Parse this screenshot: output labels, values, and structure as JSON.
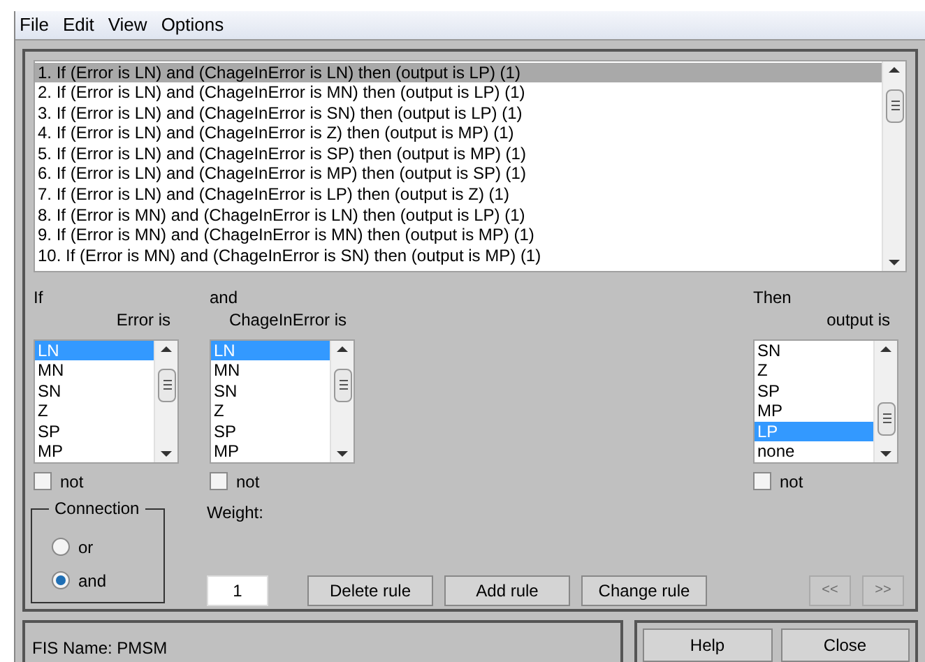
{
  "menu": [
    "File",
    "Edit",
    "View",
    "Options"
  ],
  "rules": [
    {
      "text": "1. If (Error is LN) and (ChageInError is LN) then (output is LP) (1)",
      "selected": true
    },
    {
      "text": "2. If (Error is LN) and (ChageInError is MN) then (output is LP) (1)",
      "selected": false
    },
    {
      "text": "3. If (Error is LN) and (ChageInError is SN) then (output is LP) (1)",
      "selected": false
    },
    {
      "text": "4. If (Error is LN) and (ChageInError is Z) then (output is MP) (1)",
      "selected": false
    },
    {
      "text": "5. If (Error is LN) and (ChageInError is SP) then (output is MP) (1)",
      "selected": false
    },
    {
      "text": "6. If (Error is LN) and (ChageInError is MP) then (output is SP) (1)",
      "selected": false
    },
    {
      "text": "7. If (Error is LN) and (ChageInError is LP) then (output is Z) (1)",
      "selected": false
    },
    {
      "text": "8. If (Error is MN) and (ChageInError is LN) then (output is LP) (1)",
      "selected": false
    },
    {
      "text": "9. If (Error is MN) and (ChageInError is MN) then (output is MP) (1)",
      "selected": false
    },
    {
      "text": "10. If (Error is MN) and (ChageInError is SN) then (output is MP) (1)",
      "selected": false
    }
  ],
  "variables": [
    {
      "prefix": "If",
      "label": "Error is",
      "items": [
        {
          "text": "LN",
          "selected": true
        },
        {
          "text": "MN",
          "selected": false
        },
        {
          "text": "SN",
          "selected": false
        },
        {
          "text": "Z",
          "selected": false
        },
        {
          "text": "SP",
          "selected": false
        },
        {
          "text": "MP",
          "selected": false
        }
      ],
      "not_label": "not",
      "not_checked": false
    },
    {
      "prefix": "and",
      "label": "ChageInError is",
      "items": [
        {
          "text": "LN",
          "selected": true
        },
        {
          "text": "MN",
          "selected": false
        },
        {
          "text": "SN",
          "selected": false
        },
        {
          "text": "Z",
          "selected": false
        },
        {
          "text": "SP",
          "selected": false
        },
        {
          "text": "MP",
          "selected": false
        }
      ],
      "not_label": "not",
      "not_checked": false
    },
    {
      "prefix": "Then",
      "label": "output is",
      "items": [
        {
          "text": "SN",
          "selected": false
        },
        {
          "text": "Z",
          "selected": false
        },
        {
          "text": "SP",
          "selected": false
        },
        {
          "text": "MP",
          "selected": false
        },
        {
          "text": "LP",
          "selected": true
        },
        {
          "text": "none",
          "selected": false
        }
      ],
      "not_label": "not",
      "not_checked": false
    }
  ],
  "connection": {
    "title": "Connection",
    "options": [
      {
        "label": "or",
        "selected": false
      },
      {
        "label": "and",
        "selected": true
      }
    ]
  },
  "weight": {
    "label": "Weight:",
    "value": "1"
  },
  "actions": [
    {
      "label": "Delete rule",
      "disabled": false
    },
    {
      "label": "Add rule",
      "disabled": false
    },
    {
      "label": "Change rule",
      "disabled": false
    }
  ],
  "nav": [
    {
      "label": "<<",
      "disabled": true
    },
    {
      "label": ">>",
      "disabled": true
    }
  ],
  "status": "FIS Name: PMSM",
  "footer_buttons": [
    "Help",
    "Close"
  ]
}
